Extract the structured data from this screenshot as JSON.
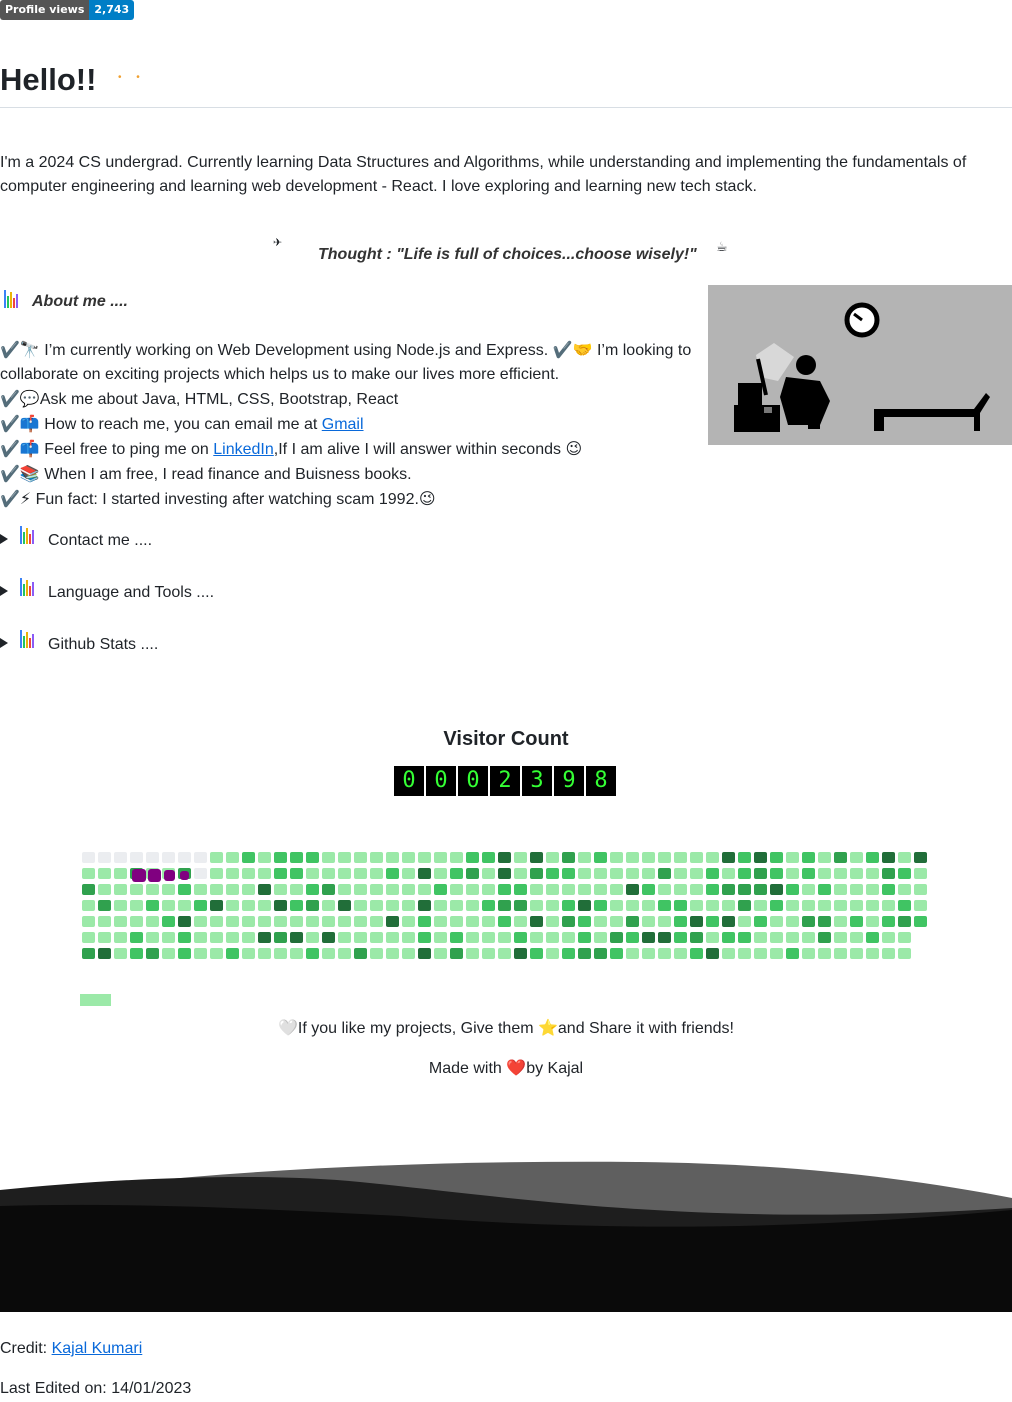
{
  "badge": {
    "label": "Profile views",
    "value": "2,743"
  },
  "heading": "Hello!!",
  "intro": "I'm a 2024 CS undergrad. Currently learning Data Structures and Algorithms, while understanding and implementing the fundamentals of computer engineering and learning web development - React. I love exploring and learning new tech stack.",
  "thought": "Thought : \"Life is full of choices...choose wisely!\"",
  "about_title": "About me ....",
  "about_items": [
    {
      "prefix": "✔️🔭",
      "text": " I’m currently working on Web Development using Node.js and Express. ✔️🤝  I’m looking to collaborate on exciting projects which helps us to make our lives more efficient."
    },
    {
      "prefix": "✔️💬",
      "text": "Ask me about Java, HTML, CSS, Bootstrap, React"
    },
    {
      "prefix": "✔️📫",
      "text": " How to reach me, you can email me at ",
      "link": "Gmail"
    },
    {
      "prefix": "✔️📫",
      "text": " Feel free to ping me on ",
      "link": "LinkedIn",
      "suffix": ",If I am alive I will answer within seconds 😉"
    },
    {
      "prefix": "✔️📚",
      "text": " When I am free, I read finance and Buisness books."
    },
    {
      "prefix": "✔️⚡",
      "text": " Fun fact: I started investing after watching scam 1992.😉"
    }
  ],
  "sections": [
    "Contact me ....",
    "Language and Tools ....",
    "Github Stats ...."
  ],
  "visitor_title": "Visitor Count",
  "visitor_digits": [
    "0",
    "0",
    "0",
    "2",
    "3",
    "9",
    "8"
  ],
  "share_text": {
    "pre": "🤍",
    "a": "If you like my projects, Give them ",
    "star": "⭐",
    "b": "and Share it with friends!"
  },
  "made_text": {
    "a": "Made with ",
    "heart": "❤️",
    "b": "by Kajal"
  },
  "credit": {
    "label": "Credit: ",
    "link": "Kajal Kumari"
  },
  "last_edited": "Last Edited on: 14/01/2023",
  "colors": {
    "empty": "#ebedf0",
    "level1": "#9be9a8",
    "level2": "#40c463",
    "level3": "#30a14e",
    "level4": "#216e39",
    "snake": "#800080"
  },
  "icons": [
    "bar-chart-icon",
    "telescope-icon",
    "handshake-icon",
    "speech-bubble-icon",
    "mailbox-icon",
    "books-icon",
    "lightning-icon",
    "heart-icon",
    "star-icon",
    "clock-icon"
  ]
}
